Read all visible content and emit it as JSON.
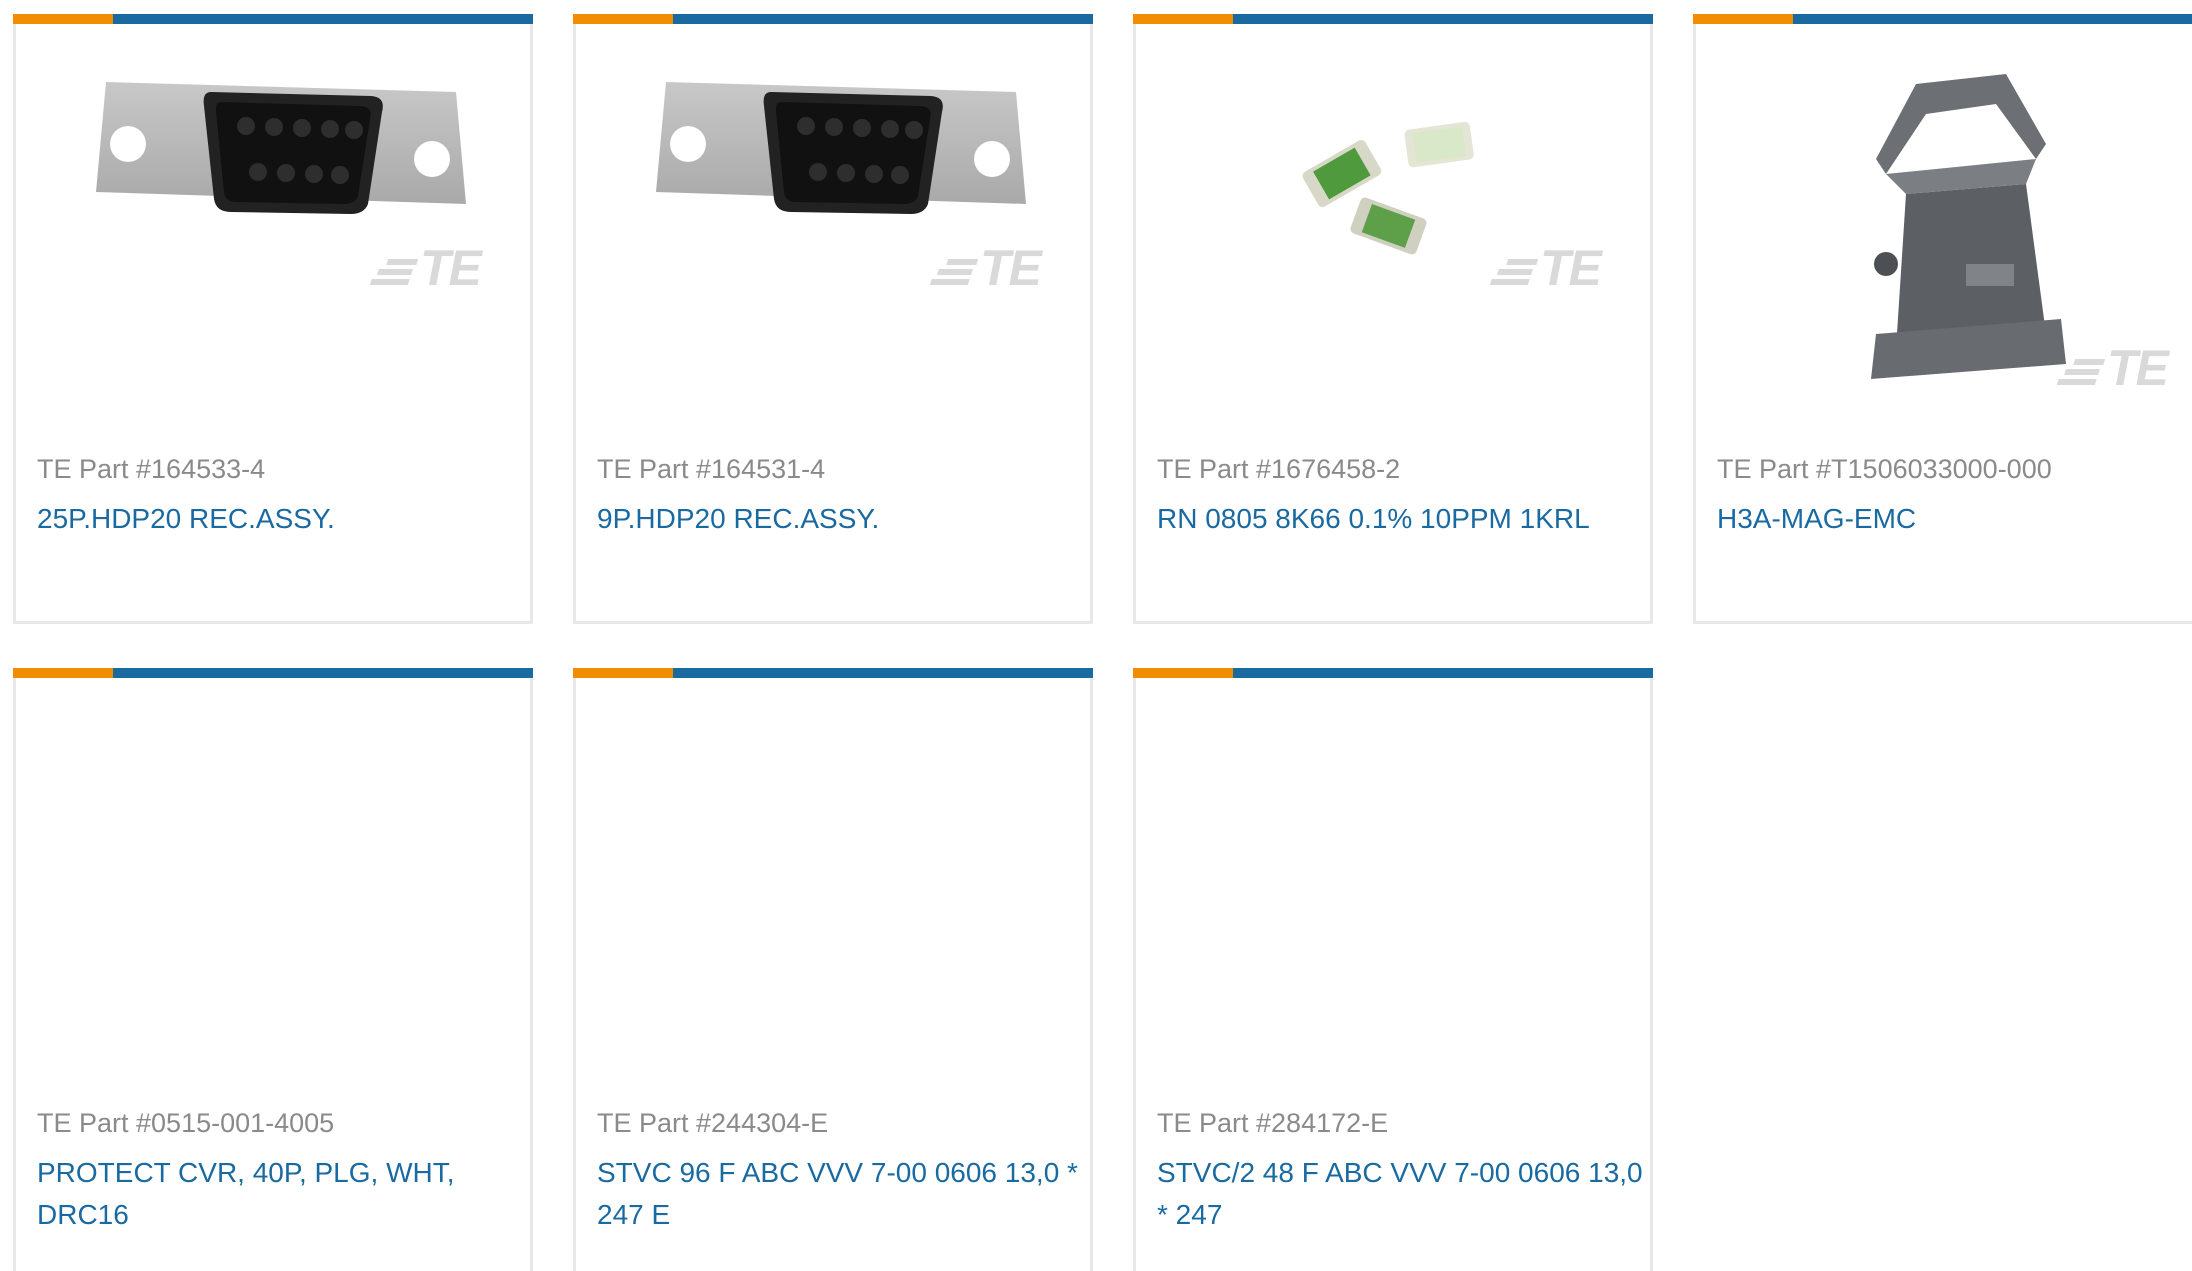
{
  "brand": {
    "orange": "#f28d00",
    "blue": "#1a6aa2",
    "logo_text": "TE"
  },
  "cards": [
    {
      "part": "TE Part #164533-4",
      "desc": "25P.HDP20 REC.ASSY.",
      "image": "dsub-25-connector"
    },
    {
      "part": "TE Part #164531-4",
      "desc": "9P.HDP20 REC.ASSY.",
      "image": "dsub-9-connector"
    },
    {
      "part": "TE Part #1676458-2",
      "desc": "RN 0805 8K66 0.1% 10PPM 1KRL",
      "image": "smd-resistors"
    },
    {
      "part": "TE Part #T1506033000-000",
      "desc": "H3A-MAG-EMC",
      "image": "connector-housing"
    },
    {
      "part": "TE Part #0515-001-4005",
      "desc": "PROTECT CVR, 40P, PLG, WHT, DRC16",
      "image": ""
    },
    {
      "part": "TE Part #244304-E",
      "desc": "STVC 96 F ABC VVV 7-00 0606 13,0 * 247 E",
      "image": ""
    },
    {
      "part": "TE Part #284172-E",
      "desc": "STVC/2 48 F ABC VVV 7-00 0606 13,0 * 247",
      "image": ""
    }
  ]
}
